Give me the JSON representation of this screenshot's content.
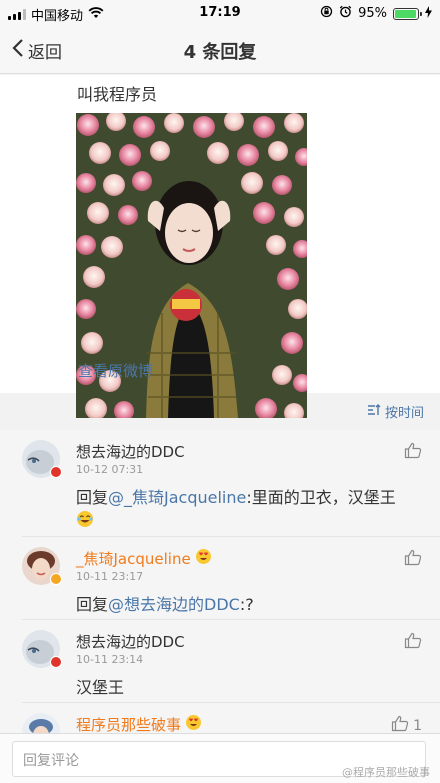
{
  "status_bar": {
    "carrier": "中国移动",
    "time": "17:19",
    "battery": "95%",
    "battery_level": 0.95
  },
  "nav": {
    "back_label": "返回",
    "title": "4 条回复"
  },
  "post": {
    "text": "叫我程序员",
    "view_original": "查看原微博"
  },
  "sort": {
    "label": "按时间"
  },
  "comments": [
    {
      "author": "想去海边的DDC",
      "time": "10-12 07:31",
      "reply_prefix": "回复",
      "mention": "@_焦琦Jacqueline",
      "text": ":里面的卫衣，汉堡王",
      "emoji": "laughing-crying",
      "badge_color": "#e0352b"
    },
    {
      "author": "_焦琦Jacqueline",
      "time": "10-11 23:17",
      "reply_prefix": "回复",
      "mention": "@想去海边的DDC",
      "text": ":?",
      "badge_color": "#f5a623"
    },
    {
      "author": "想去海边的DDC",
      "time": "10-11 23:14",
      "text": "汉堡王",
      "badge_color": "#e0352b"
    },
    {
      "author": "程序员那些破事",
      "like_count": "1"
    }
  ],
  "input": {
    "placeholder": "回复评论"
  },
  "watermark": "@程序员那些破事",
  "colors": {
    "link": "#4b77a8",
    "accent_orange": "#f07b1c"
  }
}
